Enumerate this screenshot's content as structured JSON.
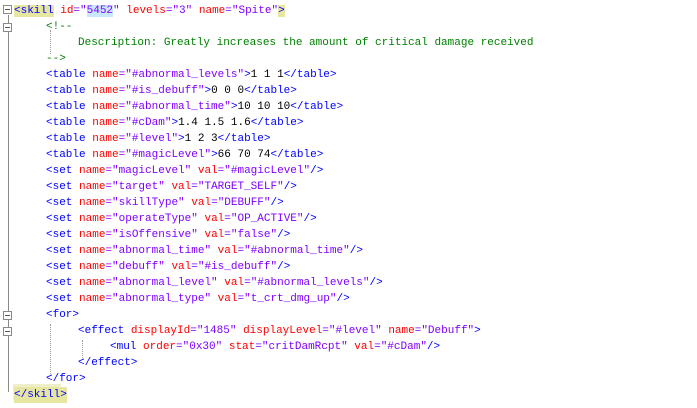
{
  "skill_open": {
    "tag": "<skill",
    "id_attr": "id",
    "id_q1": "=\"",
    "id_value": "5452",
    "id_q2": "\"",
    "levels_attr": "levels",
    "levels_value": "=\"3\"",
    "name_attr": "name",
    "name_value": "=\"Spite\"",
    "close": ">"
  },
  "comment": {
    "open": "<!--",
    "text": "Description: Greatly increases the amount of critical damage received",
    "close": "-->"
  },
  "tables": [
    {
      "name": "\"#abnormal_levels\"",
      "value": "1 1 1"
    },
    {
      "name": "\"#is_debuff\"",
      "value": "0 0 0"
    },
    {
      "name": "\"#abnormal_time\"",
      "value": "10 10 10"
    },
    {
      "name": "\"#cDam\"",
      "value": "1.4 1.5 1.6"
    },
    {
      "name": "\"#level\"",
      "value": "1 2 3"
    },
    {
      "name": "\"#magicLevel\"",
      "value": "66 70 74"
    }
  ],
  "sets": [
    {
      "name": "\"magicLevel\"",
      "val": "\"#magicLevel\""
    },
    {
      "name": "\"target\"",
      "val": "\"TARGET_SELF\""
    },
    {
      "name": "\"skillType\"",
      "val": "\"DEBUFF\""
    },
    {
      "name": "\"operateType\"",
      "val": "\"OP_ACTIVE\""
    },
    {
      "name": "\"isOffensive\"",
      "val": "\"false\""
    },
    {
      "name": "\"abnormal_time\"",
      "val": "\"#abnormal_time\""
    },
    {
      "name": "\"debuff\"",
      "val": "\"#is_debuff\""
    },
    {
      "name": "\"abnormal_level\"",
      "val": "\"#abnormal_levels\""
    },
    {
      "name": "\"abnormal_type\"",
      "val": "\"t_crt_dmg_up\""
    }
  ],
  "for_open": "<for>",
  "effect": {
    "tag": "<effect",
    "a1": "displayId",
    "v1": "=\"1485\"",
    "a2": "displayLevel",
    "v2": "=\"#level\"",
    "a3": "name",
    "v3": "=\"Debuff\"",
    "close": ">"
  },
  "mul": {
    "tag": "<mul",
    "a1": "order",
    "v1": "=\"0x30\"",
    "a2": "stat",
    "v2": "=\"critDamRcpt\"",
    "a3": "val",
    "v3": "=\"#cDam\"",
    "close": "/>"
  },
  "effect_close": "</effect>",
  "for_close": "</for>",
  "skill_close": "</skill>"
}
